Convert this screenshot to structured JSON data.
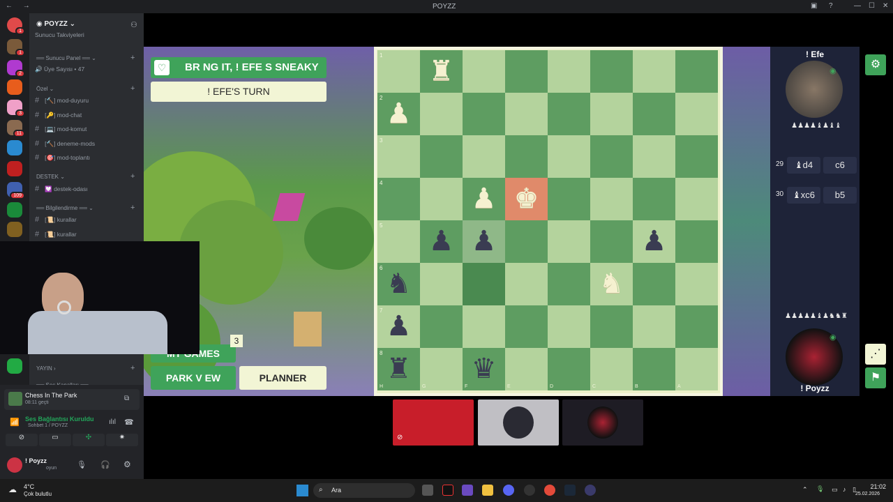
{
  "window": {
    "title": "POYZZ",
    "nav": "← →"
  },
  "server": {
    "name": "POYZZ",
    "member_count": "Üye Sayısı • 47",
    "partial_top": "Sunucu Takviyeleri",
    "categories": [
      {
        "name": "══ Sunucu Panel ══ ⌄"
      },
      {
        "name": "Özel ⌄"
      },
      {
        "name": "DESTEK ⌄"
      },
      {
        "name": "══ Bilgilendirme ══ ⌄"
      },
      {
        "name": "YAYIN ›"
      },
      {
        "name": "══ Ses Kanalları ══"
      }
    ],
    "channels": [
      {
        "label": "[🔨] mod-duyuru"
      },
      {
        "label": "[🔑] mod-chat"
      },
      {
        "label": "[💻] mod-komut"
      },
      {
        "label": "[🔨] deneme-mods"
      },
      {
        "label": "[🎯] mod-toplantı"
      },
      {
        "label": "💟 destek-odası"
      },
      {
        "label": "[📜] kurallar"
      },
      {
        "label": "[📜] kurallar"
      }
    ],
    "server_badges": [
      "1",
      "1",
      "1",
      "2",
      "3",
      "11",
      "109"
    ]
  },
  "activity": {
    "title": "Chess In The Park",
    "time": "08:11 geçti"
  },
  "voice": {
    "status": "Ses Bağlantısı Kuruldu",
    "channel": "Sohbet 1 / POYZZ"
  },
  "user": {
    "name": "! Poyzz",
    "status": "oyun"
  },
  "game": {
    "banner": "BR NG IT, ! EFE  S SNEAKY",
    "turn": "! EFE'S TURN",
    "my_games": "MY GAMES",
    "games_count": "3",
    "park_view": "PARK V EW",
    "planner": "PLANNER",
    "ranks": [
      "1",
      "2",
      "3",
      "4",
      "5",
      "6",
      "7",
      "8"
    ],
    "files": [
      "H",
      "G",
      "F",
      "E",
      "D",
      "C",
      "B",
      "A"
    ],
    "pieces": [
      {
        "sq": [
          0,
          1
        ],
        "c": "w",
        "g": "♜"
      },
      {
        "sq": [
          1,
          0
        ],
        "c": "w",
        "g": "♟"
      },
      {
        "sq": [
          3,
          2
        ],
        "c": "w",
        "g": "♟"
      },
      {
        "sq": [
          3,
          3
        ],
        "c": "w",
        "g": "♚"
      },
      {
        "sq": [
          4,
          1
        ],
        "c": "b",
        "g": "♟"
      },
      {
        "sq": [
          4,
          2
        ],
        "c": "b",
        "g": "♟"
      },
      {
        "sq": [
          4,
          6
        ],
        "c": "b",
        "g": "♟"
      },
      {
        "sq": [
          5,
          0
        ],
        "c": "b",
        "g": "♞"
      },
      {
        "sq": [
          5,
          5
        ],
        "c": "w",
        "g": "♞"
      },
      {
        "sq": [
          6,
          0
        ],
        "c": "b",
        "g": "♟"
      },
      {
        "sq": [
          7,
          0
        ],
        "c": "b",
        "g": "♜"
      },
      {
        "sq": [
          7,
          2
        ],
        "c": "b",
        "g": "♛"
      }
    ]
  },
  "opponent": {
    "name": "! Efe",
    "captured": "♟♟♟♟♝♟♝♝"
  },
  "player": {
    "name": "! Poyzz",
    "captured": "♟♟♟♟♟♝♟♞♞♜"
  },
  "moves": [
    {
      "n": "29",
      "w": "♝d4",
      "b": "c6"
    },
    {
      "n": "30",
      "w": "♝xc6",
      "b": "b5"
    }
  ],
  "taskbar": {
    "weather_temp": "4°C",
    "weather_desc": "Çok bulutlu",
    "search": "Ara",
    "time": "21:02",
    "date": "25.02.2026"
  }
}
